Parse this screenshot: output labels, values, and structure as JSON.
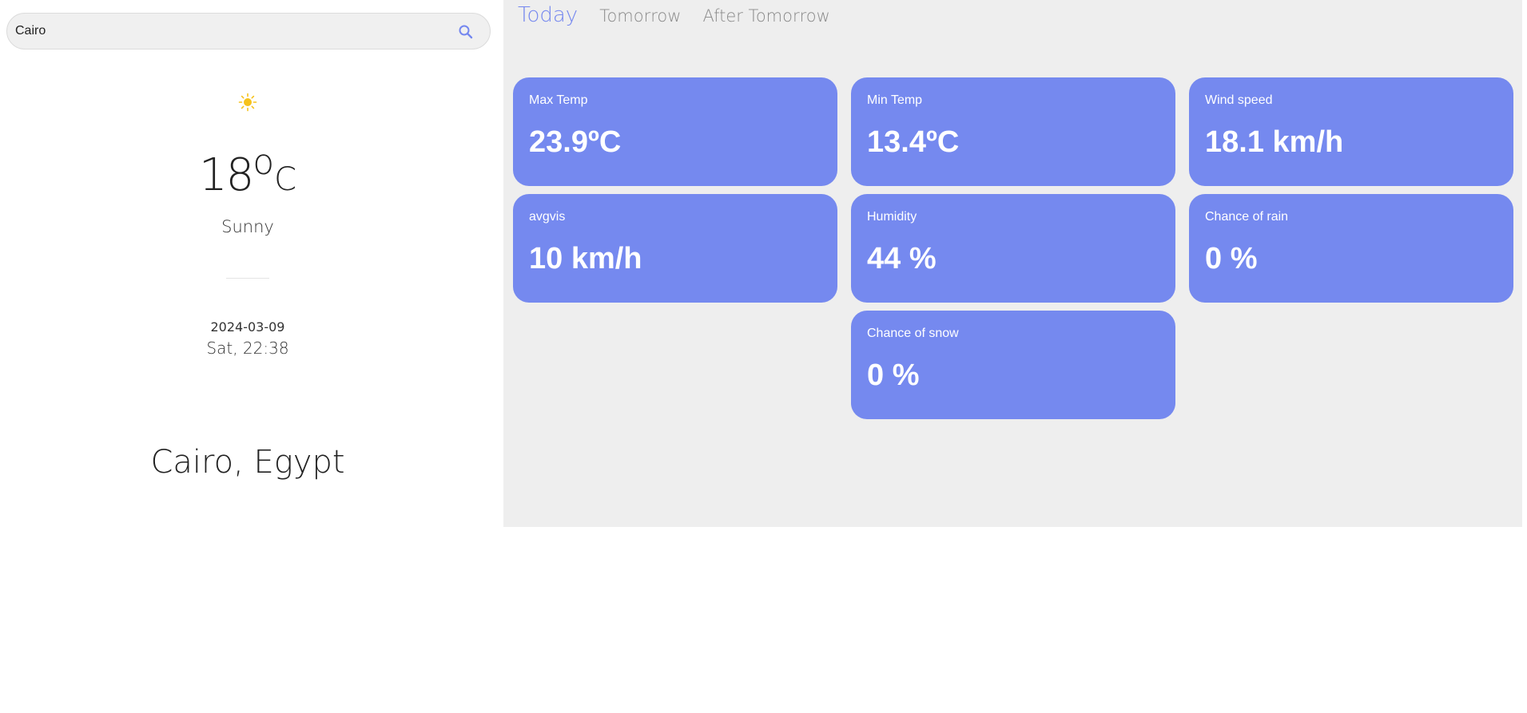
{
  "search": {
    "value": "Cairo"
  },
  "current": {
    "temp": "18",
    "degree_symbol": "o",
    "unit": "C",
    "condition": "Sunny",
    "date": "2024-03-09",
    "time": "Sat, 22:38",
    "location": "Cairo, Egypt"
  },
  "tabs": [
    {
      "label": "Today",
      "active": true
    },
    {
      "label": "Tomorrow",
      "active": false
    },
    {
      "label": "After Tomorrow",
      "active": false
    }
  ],
  "stats": [
    {
      "label": "Max Temp",
      "value": "23.9ºC"
    },
    {
      "label": "Min Temp",
      "value": "13.4ºC"
    },
    {
      "label": "Wind speed",
      "value": "18.1 km/h"
    },
    {
      "label": "avgvis",
      "value": "10 km/h"
    },
    {
      "label": "Humidity",
      "value": "44 %"
    },
    {
      "label": "Chance of rain",
      "value": "0 %"
    },
    {
      "label": "Chance of snow",
      "value": "0 %"
    }
  ],
  "colors": {
    "accent": "#7589ef",
    "panel_bg": "#eeeeee",
    "sun": "#f6c21c"
  },
  "icons": {
    "search": "search-icon",
    "weather": "sun-icon"
  }
}
